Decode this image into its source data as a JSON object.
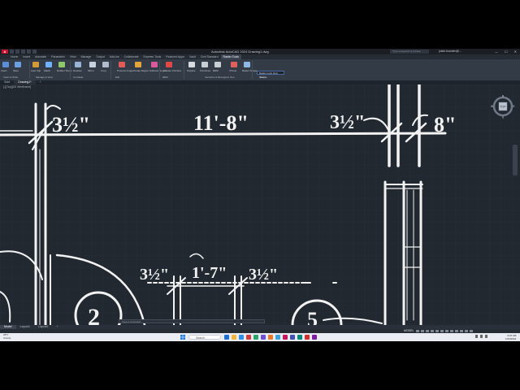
{
  "app": {
    "title": "Autodesk AutoCAD 2024   Drawing1.dwg",
    "logo_letter": "A"
  },
  "search": {
    "placeholder": "Type a keyword or phrase"
  },
  "user": {
    "name": "justin.bowden@..."
  },
  "window_controls": [
    "—",
    "☐",
    "✕"
  ],
  "ribbon_tabs": [
    "Home",
    "Insert",
    "Annotate",
    "Parametric",
    "View",
    "Manage",
    "Output",
    "Add-ins",
    "Collaborate",
    "Express Tools",
    "Featured Apps",
    "Vault",
    "Civil Standard",
    "Raster Tools"
  ],
  "ribbon_active_tab": "Raster Tools",
  "ribbon": {
    "buttons": [
      {
        "label": "Insert",
        "color": "#5a8fd8"
      },
      {
        "label": "Save",
        "color": "#6a9fe0"
      },
      {
        "label": "Auto Clip",
        "color": "#d49a3a"
      },
      {
        "label": "Match",
        "color": "#6fb0ff"
      },
      {
        "label": "Rubber Sheet",
        "color": "#8fc86a"
      },
      {
        "label": "Deskew",
        "color": "#9ab4d8"
      },
      {
        "label": "Mirror",
        "color": "#c6d1df"
      },
      {
        "label": "Crop",
        "color": "#b0bccb"
      },
      {
        "label": "Process Image",
        "color": "#e05a5a"
      },
      {
        "label": "Create Region",
        "color": "#e3a53b"
      },
      {
        "label": "Subtract Region",
        "color": "#d85a9c"
      },
      {
        "label": "Create Primitive",
        "color": "#e04848"
      },
      {
        "label": "Polyline",
        "color": "#d7dbe0"
      },
      {
        "label": "Primitives",
        "color": "#c9ced5"
      },
      {
        "label": "REM",
        "color": "#c9ced5"
      },
      {
        "label": "VTools",
        "color": "#e06060"
      },
      {
        "label": "Raster Snaps",
        "color": "#8fb7e6"
      }
    ],
    "panels": [
      "Insert & Write",
      "Manage & View",
      "Correlate",
      "Edit",
      "REM",
      "Vectorize & Recognize Text",
      "Snap"
    ],
    "layer_value": "Raster Lock Grid Source"
  },
  "file_tabs": [
    "Start",
    "Drawing1*"
  ],
  "file_tab_active": "Drawing1*",
  "file_tab_plus": "+",
  "viewport_label": "[-][Top][2D Wireframe]",
  "drawing": {
    "dimensions": [
      "3½\"",
      "11'-8\"",
      "3½\"",
      "8\"",
      "3½\"",
      "1'-7\"",
      "3½\""
    ],
    "tags": [
      "2",
      "5"
    ]
  },
  "viewcube": {
    "face": "TOP",
    "compass": [
      "N",
      "S",
      "E",
      "W"
    ]
  },
  "command_line": {
    "placeholder": "Type a command"
  },
  "layout_tabs": [
    "Model",
    "Layout1",
    "Layout2",
    "+"
  ],
  "layout_active": "Model",
  "status": {
    "space": "MODEL"
  },
  "taskbar": {
    "weather_line1": "28°F",
    "weather_line2": "Cloudy",
    "search_label": "Search",
    "apps": [
      "#1f6fd1",
      "#f2b43b",
      "#2f8fe6",
      "#d43b3b",
      "#2ca36b",
      "#6b4fd8",
      "#e8772e",
      "#3aa0e0",
      "#c2185b",
      "#3f51b5",
      "#00897b",
      "#d32f2f",
      "#7b1fa2"
    ],
    "time": "9:15 AM",
    "date": "1/23/2024"
  }
}
